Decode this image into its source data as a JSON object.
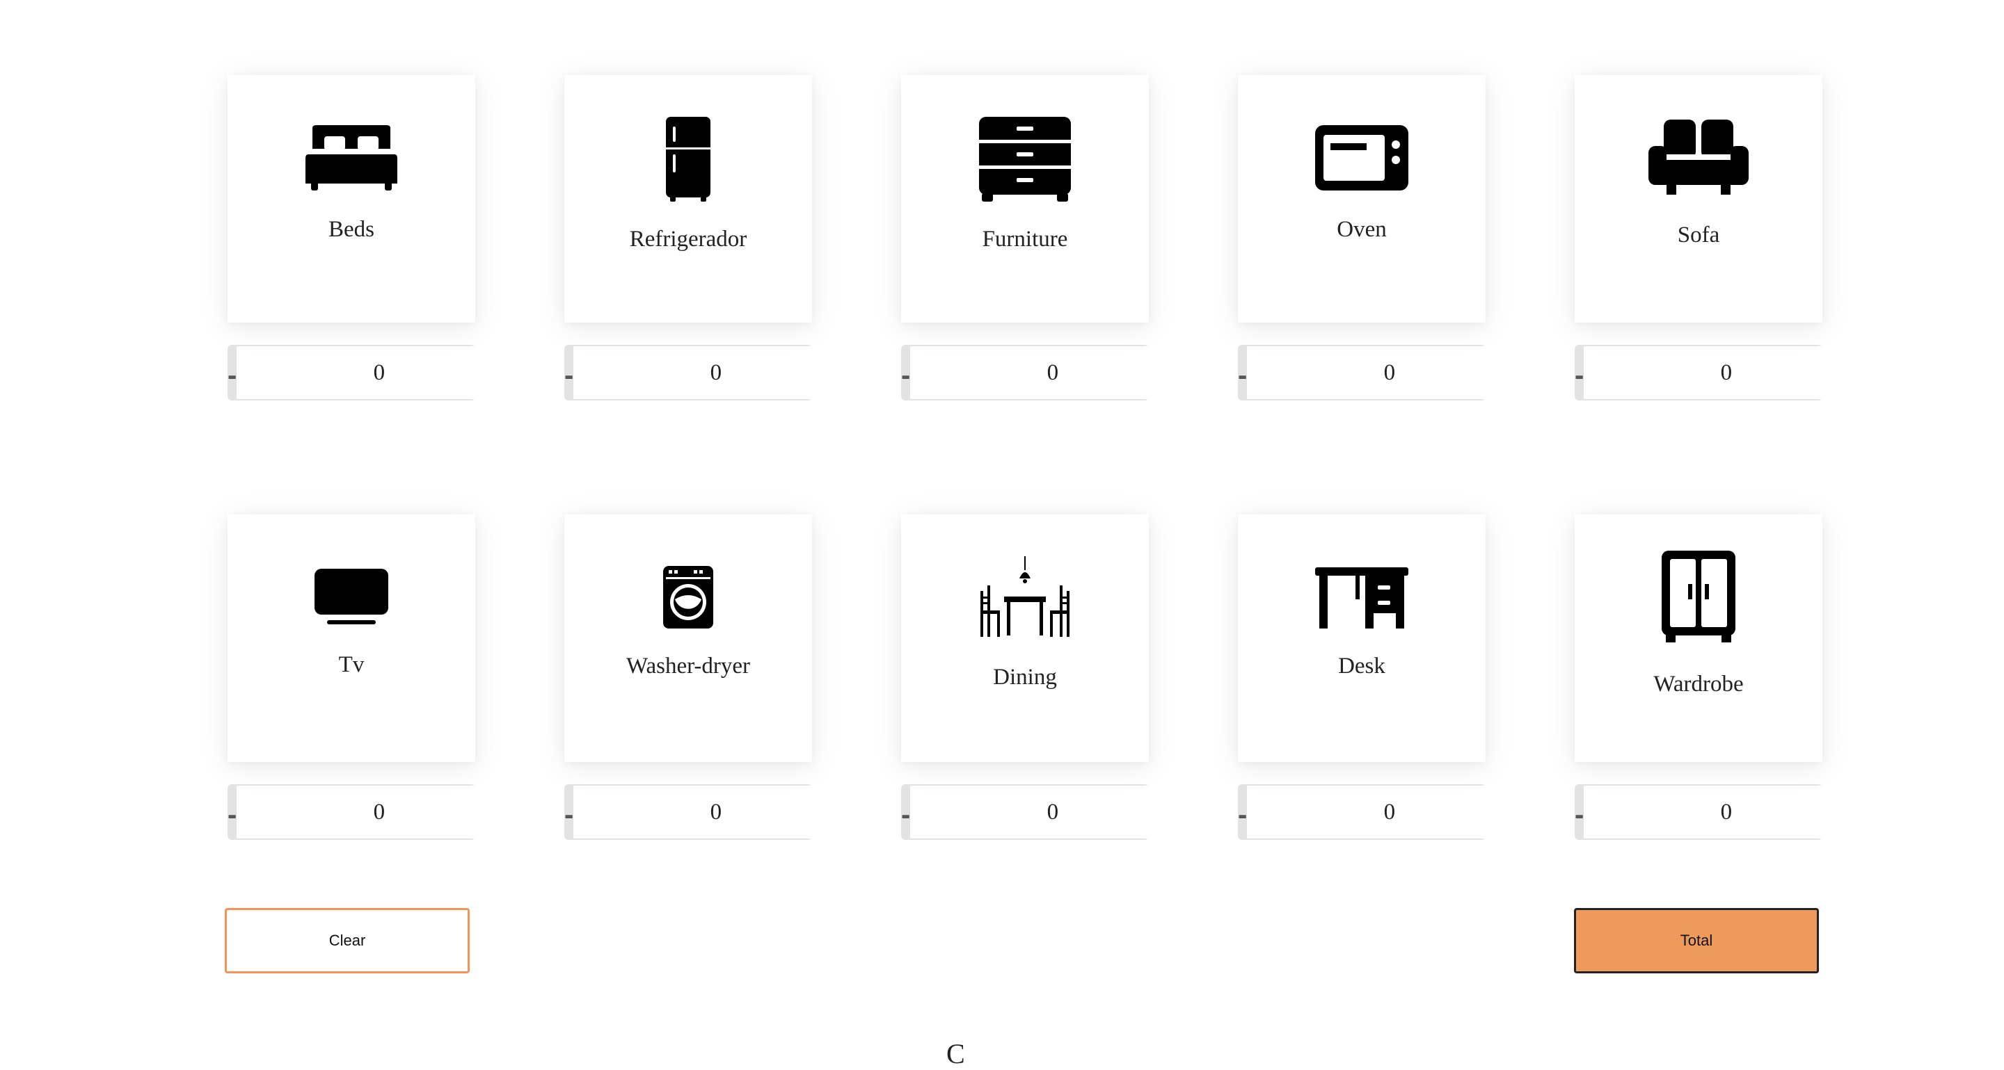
{
  "items": [
    {
      "label": "Beds",
      "icon": "bed-icon",
      "quantity": "0"
    },
    {
      "label": "Refrigerador",
      "icon": "refrigerator-icon",
      "quantity": "0"
    },
    {
      "label": "Furniture",
      "icon": "dresser-icon",
      "quantity": "0"
    },
    {
      "label": "Oven",
      "icon": "microwave-icon",
      "quantity": "0"
    },
    {
      "label": "Sofa",
      "icon": "sofa-icon",
      "quantity": "0"
    },
    {
      "label": "Tv",
      "icon": "tv-icon",
      "quantity": "0"
    },
    {
      "label": "Washer-dryer",
      "icon": "washing-machine-icon",
      "quantity": "0"
    },
    {
      "label": "Dining",
      "icon": "dining-table-icon",
      "quantity": "0"
    },
    {
      "label": "Desk",
      "icon": "desk-icon",
      "quantity": "0"
    },
    {
      "label": "Wardrobe",
      "icon": "wardrobe-icon",
      "quantity": "0"
    }
  ],
  "stepper": {
    "minus_label": "-",
    "plus_label": "+"
  },
  "actions": {
    "clear_label": "Clear",
    "total_label": "Total"
  },
  "footer": {
    "fragment": "C"
  },
  "colors": {
    "accent": "#ee9a5c",
    "accent_border": "#f0965a",
    "stepper_bg": "#e3e3e3"
  }
}
